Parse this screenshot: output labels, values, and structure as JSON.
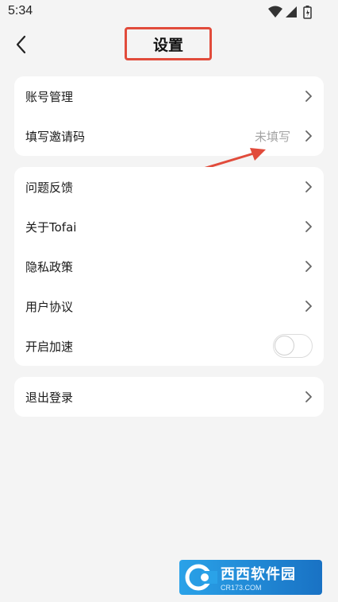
{
  "status_bar": {
    "time": "5:34"
  },
  "header": {
    "title": "设置"
  },
  "groups": [
    {
      "items": [
        {
          "label": "账号管理"
        },
        {
          "label": "填写邀请码",
          "value": "未填写"
        }
      ]
    },
    {
      "items": [
        {
          "label": "问题反馈"
        },
        {
          "label": "关于Tofai"
        },
        {
          "label": "隐私政策"
        },
        {
          "label": "用户协议"
        },
        {
          "label": "开启加速",
          "toggle_on": false
        }
      ]
    },
    {
      "items": [
        {
          "label": "退出登录"
        }
      ]
    }
  ],
  "watermark": {
    "brand": "西西软件园",
    "domain": "CR173.COM"
  },
  "colors": {
    "background": "#f4f4f4",
    "card": "#ffffff",
    "annotation": "#e14b3b",
    "muted_text": "#a4a4a4"
  },
  "icons": [
    "wifi-icon",
    "signal-icon",
    "battery-icon",
    "back-icon",
    "chevron-right-icon"
  ]
}
